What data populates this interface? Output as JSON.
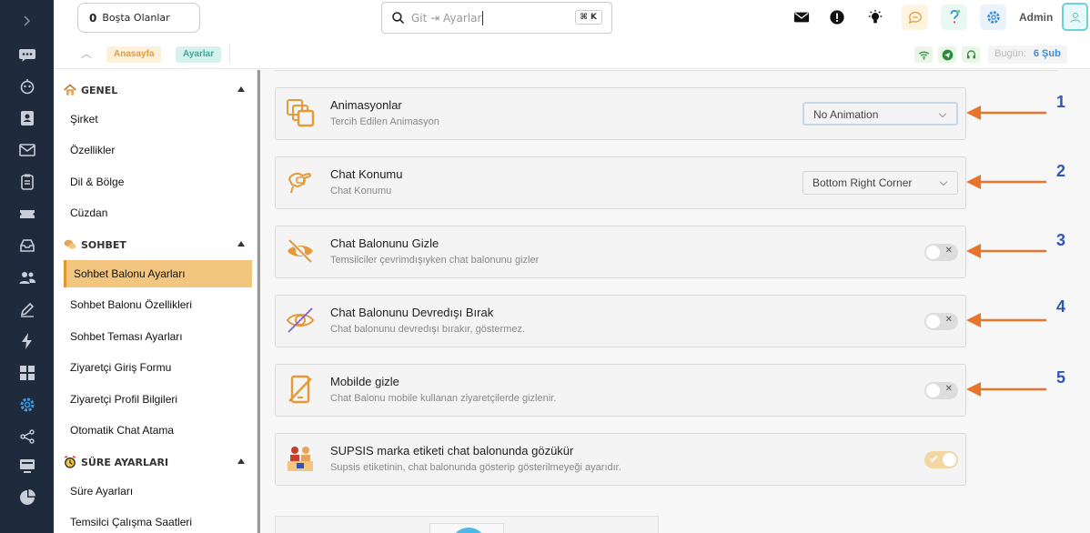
{
  "topbar": {
    "idle_count": "0",
    "idle_label": "Boşta Olanlar",
    "search_placeholder": "Git ⇥ Ayarlar",
    "search_shortcut": "⌘ K",
    "admin_label": "Admin"
  },
  "breadcrumb": {
    "home": "Anasayfa",
    "current": "Ayarlar",
    "today_label": "Bugün:",
    "today_value": "6 Şub"
  },
  "sidebar": {
    "sections": [
      {
        "title": "GENEL",
        "items": [
          "Şirket",
          "Özellikler",
          "Dil & Bölge",
          "Cüzdan"
        ]
      },
      {
        "title": "SOHBET",
        "items": [
          "Sohbet Balonu Ayarları",
          "Sohbet Balonu Özellikleri",
          "Sohbet Teması Ayarları",
          "Ziyaretçi Giriş Formu",
          "Ziyaretçi Profil Bilgileri",
          "Otomatik Chat Atama"
        ]
      },
      {
        "title": "SÜRE AYARLARI",
        "items": [
          "Süre Ayarları",
          "Temsilci Çalışma Saatleri"
        ]
      }
    ],
    "active_item": "Sohbet Balonu Ayarları"
  },
  "settings": [
    {
      "title": "Animasyonlar",
      "desc": "Tercih Edilen Animasyon",
      "control": "select",
      "value": "No Animation"
    },
    {
      "title": "Chat Konumu",
      "desc": "Chat Konumu",
      "control": "select",
      "value": "Bottom Right Corner"
    },
    {
      "title": "Chat Balonunu Gizle",
      "desc": "Temsilciler çevrimdışıyken chat balonunu gizler",
      "control": "toggle",
      "value": "off"
    },
    {
      "title": "Chat Balonunu Devredışı Bırak",
      "desc": "Chat balonunu devredışı bırakır, göstermez.",
      "control": "toggle",
      "value": "off"
    },
    {
      "title": "Mobilde gizle",
      "desc": "Chat Balonu mobile kullanan ziyaretçilerde gizlenir.",
      "control": "toggle",
      "value": "off"
    },
    {
      "title": "SUPSIS marka etiketi chat balonunda gözükür",
      "desc": "Supsis etiketinin, chat balonunda gösterip gösterilmeyeği ayarıdır.",
      "control": "toggle",
      "value": "on"
    }
  ],
  "annotations": [
    "1",
    "2",
    "3",
    "4",
    "5"
  ],
  "colors": {
    "rail_bg": "#1f2a3c",
    "accent_orange": "#e49a36",
    "active_item_bg": "#f3c680",
    "arrow": "#e8742c",
    "annotation_number": "#2c56b8",
    "settings_icon_blue": "#3c8ad9"
  }
}
